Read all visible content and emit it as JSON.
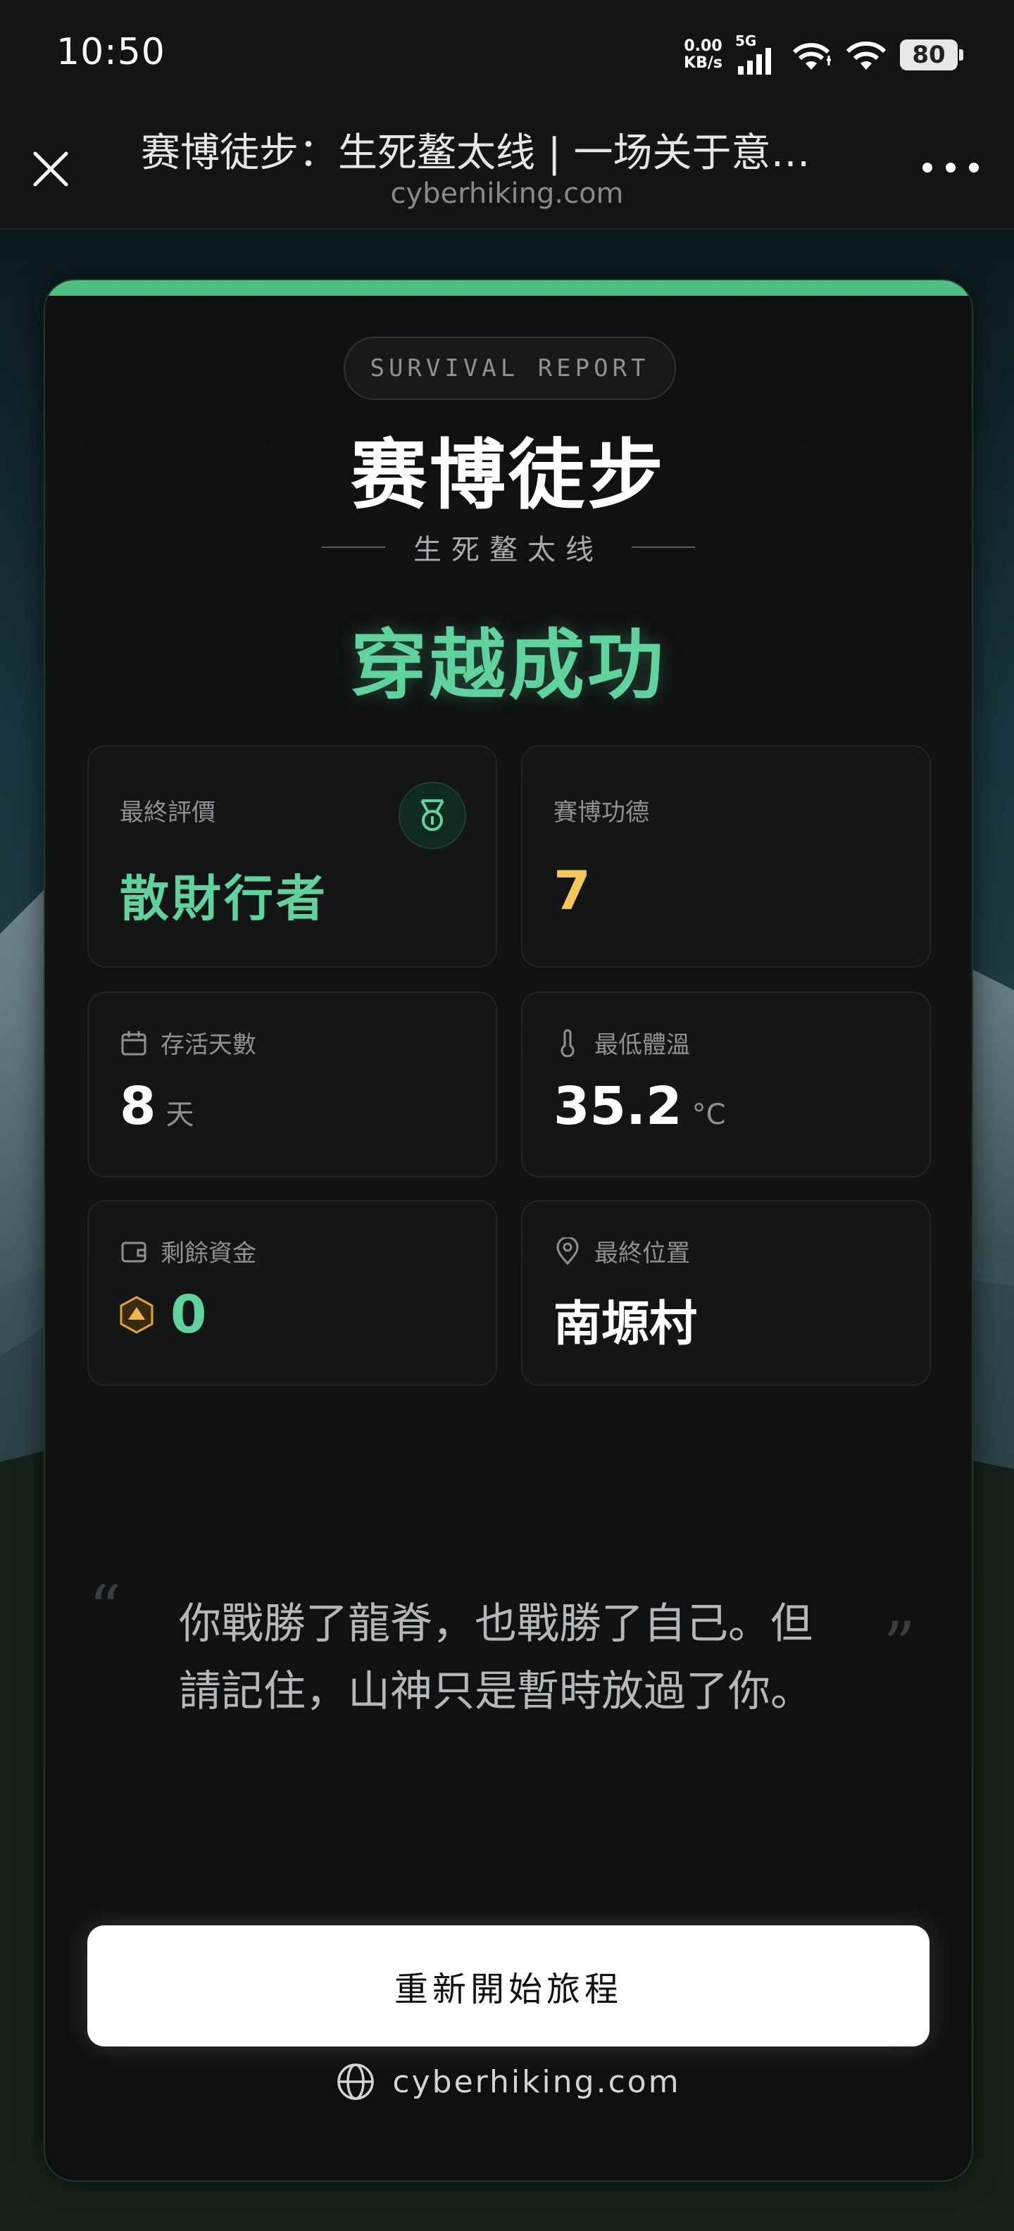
{
  "status_bar": {
    "time": "10:50",
    "net_speed_value": "0.00",
    "net_speed_unit": "KB/s",
    "network": "5G",
    "battery": "80"
  },
  "browser": {
    "title": "赛博徒步：生死鳌太线 | 一场关于意…",
    "url": "cyberhiking.com"
  },
  "report": {
    "tag": "SURVIVAL REPORT",
    "title": "赛博徒步",
    "subtitle": "生死鳌太线",
    "result": "穿越成功",
    "accent_color": "#5fd29e",
    "stats": {
      "final_rating": {
        "label": "最終評價",
        "value": "散財行者",
        "icon": "medal-icon"
      },
      "merit": {
        "label": "賽博功德",
        "value": "7"
      },
      "days": {
        "label": "存活天數",
        "value": "8",
        "unit": "天",
        "icon": "calendar-icon"
      },
      "min_temp": {
        "label": "最低體溫",
        "value": "35.2",
        "unit": "°C",
        "icon": "thermometer-icon"
      },
      "funds": {
        "label": "剩餘資金",
        "value": "0",
        "icon": "wallet-icon"
      },
      "location": {
        "label": "最終位置",
        "value": "南塬村",
        "icon": "location-pin-icon"
      }
    },
    "quote_line1": "你戰勝了龍脊，也戰勝了自己。但",
    "quote_line2": "請記住，山神只是暫時放過了你。",
    "restart_label": "重新開始旅程",
    "footer_url": "cyberhiking.com"
  }
}
